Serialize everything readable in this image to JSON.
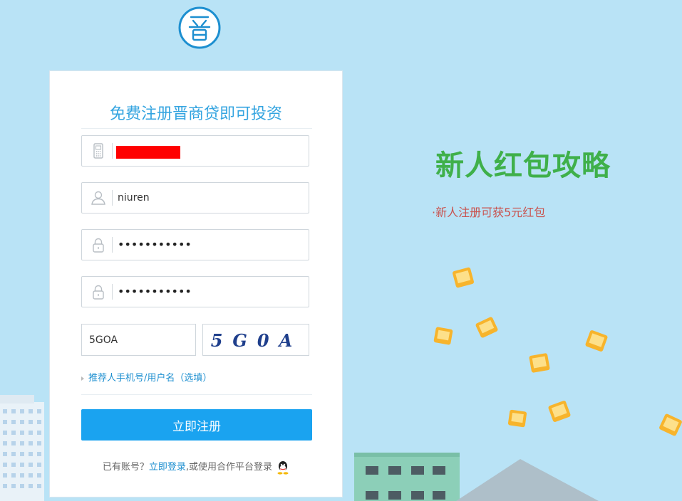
{
  "form": {
    "title": "免费注册晋商贷即可投资",
    "phone_value": "",
    "username_value": "niuren",
    "password_mask": "•••••••••••",
    "confirm_password_mask": "•••••••••••",
    "captcha_value": "5GOA",
    "captcha_image_text": "5G0A",
    "referrer_label": "推荐人手机号/用户名（选填）",
    "submit_label": "立即注册",
    "footer_prefix": "已有账号？",
    "footer_login_link": "立即登录",
    "footer_suffix": ",或使用合作平台登录"
  },
  "promo": {
    "title": "新人红包攻略",
    "subtitle": "·新人注册可获5元红包"
  },
  "colors": {
    "accent": "#1aa3f0",
    "title_blue": "#34a4e0",
    "promo_green": "#3fb04a",
    "promo_red": "#c9534f",
    "background": "#b9e3f6"
  },
  "icons": {
    "logo": "jin-logo-icon",
    "phone": "phone-icon",
    "user": "user-icon",
    "lock": "lock-icon",
    "qq": "qq-icon"
  }
}
